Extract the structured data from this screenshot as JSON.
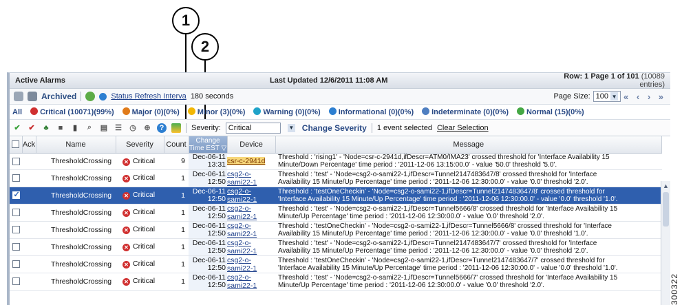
{
  "callouts": [
    "1",
    "2"
  ],
  "figure_id": "300322",
  "header": {
    "title": "Active Alarms",
    "updated": "Last Updated 12/6/2011 11:08 AM",
    "row_prefix": "Row: 1 Page 1 of 101",
    "row_entries": "(10089 entries)"
  },
  "toolbar2": {
    "archived": "Archived",
    "refresh_label": "Status Refresh Interva",
    "refresh_value": "180 seconds",
    "page_size_label": "Page Size:",
    "page_size_value": "100",
    "nav": "«  ‹  ›  »"
  },
  "filters": [
    {
      "label": "All",
      "color": ""
    },
    {
      "label": "Critical (10071)(99%)",
      "color": "#d03030"
    },
    {
      "label": "Major (0)(0%)",
      "color": "#e07b1a"
    },
    {
      "label": "Minor (3)(0%)",
      "color": "#f2b705"
    },
    {
      "label": "Warning (0)(0%)",
      "color": "#1fa3c9"
    },
    {
      "label": "Informational (0)(0%)",
      "color": "#2d7fd1"
    },
    {
      "label": "Indeterminate (0)(0%)",
      "color": "#4f7fc1"
    },
    {
      "label": "Normal (15)(0%)",
      "color": "#45a845"
    }
  ],
  "toolbar4": {
    "severity_label": "Severity:",
    "severity_value": "Critical",
    "change_severity": "Change Severity",
    "selected_text": "1 event selected",
    "clear_selection": "Clear Selection"
  },
  "columns": {
    "ack": "Ack",
    "name": "Name",
    "severity": "Severity",
    "count": "Count",
    "change_time_1": "Change",
    "change_time_2": "Time EST",
    "device": "Device",
    "message": "Message"
  },
  "rows": [
    {
      "name": "ThresholdCrossing",
      "severity": "Critical",
      "count": "9",
      "date": "Dec-06-11",
      "time": "13:31",
      "device": "csr-c-2941d",
      "msg1": "Threshold : 'rising1' - 'Node=csr-c-2941d,ifDescr=ATM0/IMA23' crossed threshold for 'Interface Availability 15",
      "msg2": "Minute/Down Percentage' time period : '2011-12-06 13:15:00.0' - value '50.0' threshold '5.0'."
    },
    {
      "name": "ThresholdCrossing",
      "severity": "Critical",
      "count": "1",
      "date": "Dec-06-11",
      "time": "12:50",
      "device": "csg2-o-sami22-1",
      "msg1": "Threshold : 'test' - 'Node=csg2-o-sami22-1,ifDescr=Tunnel2147483647/8' crossed threshold for 'Interface",
      "msg2": "Availability 15 Minute/Up Percentage' time period : '2011-12-06 12:30:00.0' - value '0.0' threshold '2.0'."
    },
    {
      "name": "ThresholdCrossing",
      "severity": "Critical",
      "count": "1",
      "date": "Dec-06-11",
      "time": "12:50",
      "device": "csg2-o-sami22-1",
      "msg1": "Threshold : 'testOneCheckin' - 'Node=csg2-o-sami22-1,ifDescr=Tunnel2147483647/8' crossed threshold for",
      "msg2": "'Interface Availability 15 Minute/Up Percentage' time period : '2011-12-06 12:30:00.0' - value '0.0' threshold '1.0'."
    },
    {
      "name": "ThresholdCrossing",
      "severity": "Critical",
      "count": "1",
      "date": "Dec-06-11",
      "time": "12:50",
      "device": "csg2-o-sami22-1",
      "msg1": "Threshold : 'test' - 'Node=csg2-o-sami22-1,ifDescr=Tunnel5666/8' crossed threshold for 'Interface Availability 15",
      "msg2": "Minute/Up Percentage' time period : '2011-12-06 12:30:00.0' - value '0.0' threshold '2.0'."
    },
    {
      "name": "ThresholdCrossing",
      "severity": "Critical",
      "count": "1",
      "date": "Dec-06-11",
      "time": "12:50",
      "device": "csg2-o-sami22-1",
      "msg1": "Threshold : 'testOneCheckin' - 'Node=csg2-o-sami22-1,ifDescr=Tunnel5666/8' crossed threshold for 'Interface",
      "msg2": "Availability 15 Minute/Up Percentage' time period : '2011-12-06 12:30:00.0' - value '0.0' threshold '1.0'."
    },
    {
      "name": "ThresholdCrossing",
      "severity": "Critical",
      "count": "1",
      "date": "Dec-06-11",
      "time": "12:50",
      "device": "csg2-o-sami22-1",
      "msg1": "Threshold : 'test' - 'Node=csg2-o-sami22-1,ifDescr=Tunnel2147483647/7' crossed threshold for 'Interface",
      "msg2": "Availability 15 Minute/Up Percentage' time period : '2011-12-06 12:30:00.0' - value '0.0' threshold '2.0'."
    },
    {
      "name": "ThresholdCrossing",
      "severity": "Critical",
      "count": "1",
      "date": "Dec-06-11",
      "time": "12:50",
      "device": "csg2-o-sami22-1",
      "msg1": "Threshold : 'testOneCheckin' - 'Node=csg2-o-sami22-1,ifDescr=Tunnel2147483647/7' crossed threshold for",
      "msg2": "'Interface Availability 15 Minute/Up Percentage' time period : '2011-12-06 12:30:00.0' - value '0.0' threshold '1.0'."
    },
    {
      "name": "ThresholdCrossing",
      "severity": "Critical",
      "count": "1",
      "date": "Dec-06-11",
      "time": "12:50",
      "device": "csg2-o-sami22-1",
      "msg1": "Threshold : 'test' - 'Node=csg2-o-sami22-1,ifDescr=Tunnel5666/7' crossed threshold for 'Interface Availability 15",
      "msg2": "Minute/Up Percentage' time period : '2011-12-06 12:30:00.0' - value '0.0' threshold '2.0'."
    }
  ]
}
